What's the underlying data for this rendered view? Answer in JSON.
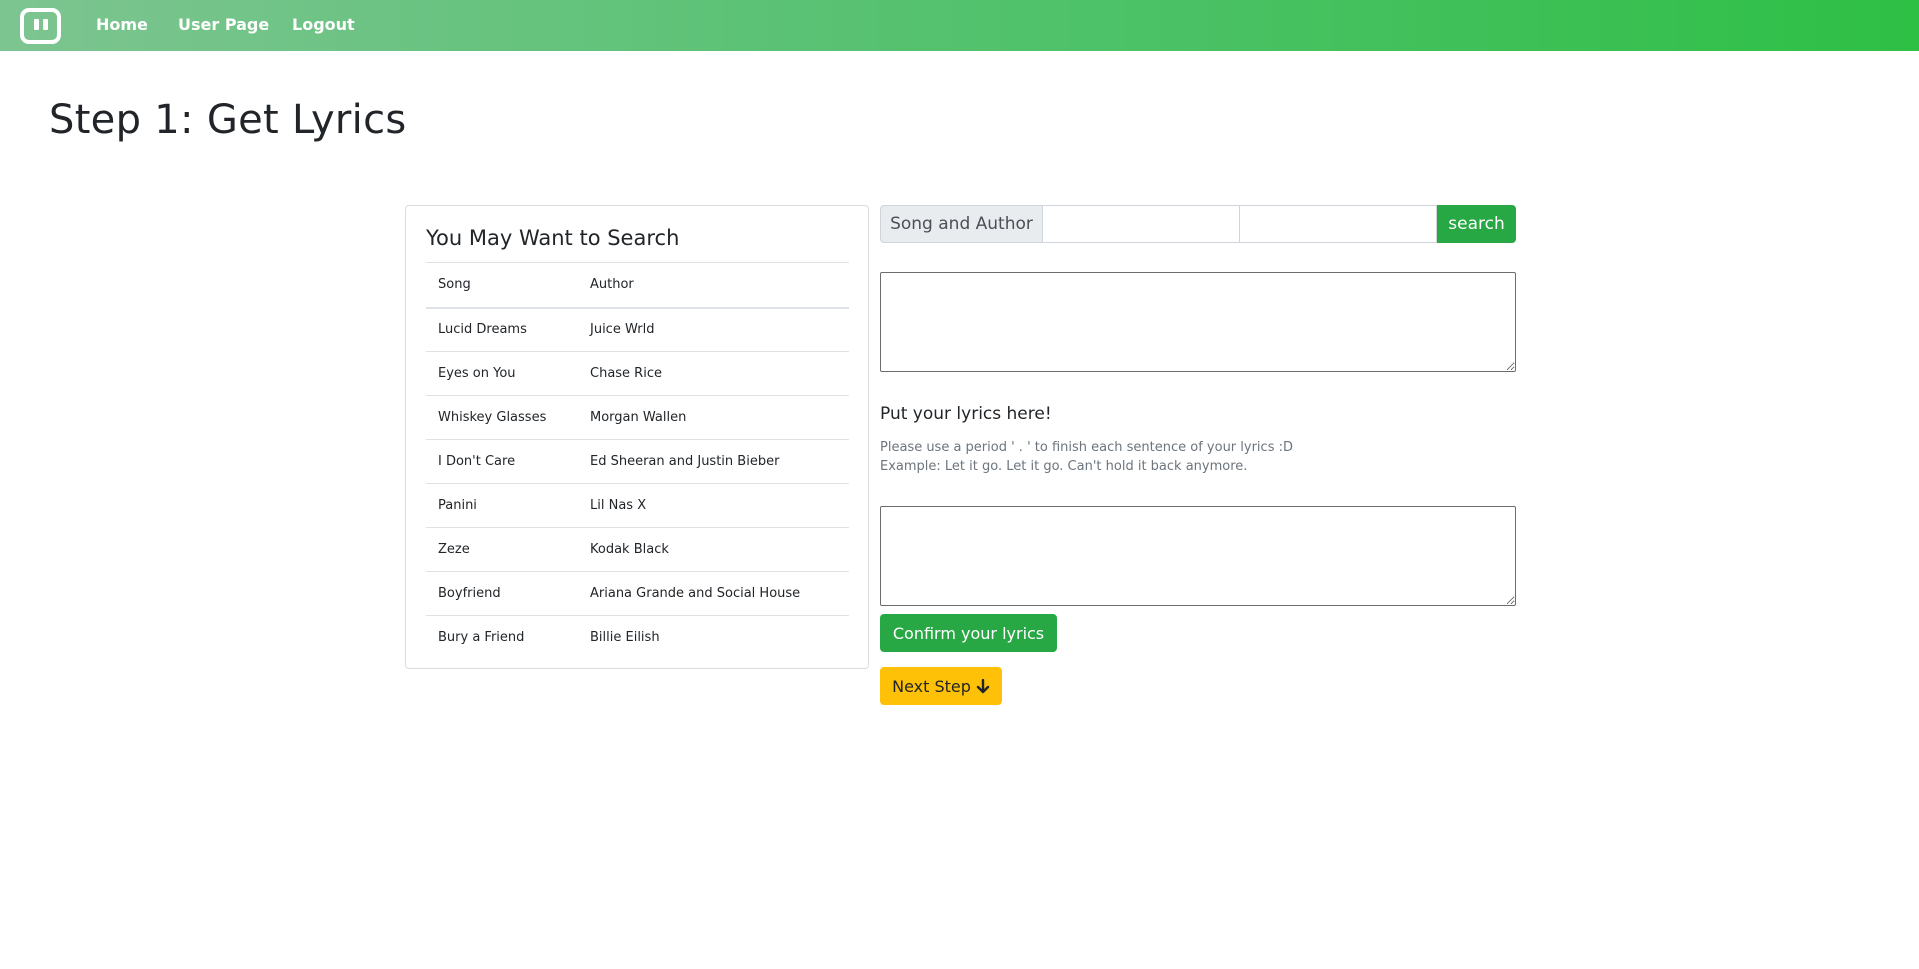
{
  "nav": {
    "logo_icon": "robot-face-icon",
    "links": [
      "Home",
      "User Page",
      "Logout"
    ]
  },
  "page": {
    "title": "Step 1: Get Lyrics"
  },
  "suggestions": {
    "title": "You May Want to Search",
    "headers": [
      "Song",
      "Author"
    ],
    "rows": [
      {
        "song": "Lucid Dreams",
        "author": "Juice Wrld"
      },
      {
        "song": "Eyes on You",
        "author": "Chase Rice"
      },
      {
        "song": "Whiskey Glasses",
        "author": "Morgan Wallen"
      },
      {
        "song": "I Don't Care",
        "author": "Ed Sheeran and Justin Bieber"
      },
      {
        "song": "Panini",
        "author": "Lil Nas X"
      },
      {
        "song": "Zeze",
        "author": "Kodak Black"
      },
      {
        "song": "Boyfriend",
        "author": "Ariana Grande and Social House"
      },
      {
        "song": "Bury a Friend",
        "author": "Billie Eilish"
      }
    ]
  },
  "search": {
    "label": "Song and Author",
    "song_value": "",
    "author_value": "",
    "button_label": "search"
  },
  "lyrics": {
    "result_value": "",
    "input_label": "Put your lyrics here!",
    "hint_line1": "Please use a period ' . ' to finish each sentence of your lyrics :D",
    "hint_line2": "Example: Let it go. Let it go. Can't hold it back anymore.",
    "input_value": "",
    "confirm_label": "Confirm your lyrics",
    "next_label": "Next Step",
    "next_icon": "arrow-down-icon"
  },
  "colors": {
    "navbar_start": "#7dc491",
    "navbar_end": "#2ebf45",
    "success": "#28a745",
    "warning": "#ffc107"
  }
}
